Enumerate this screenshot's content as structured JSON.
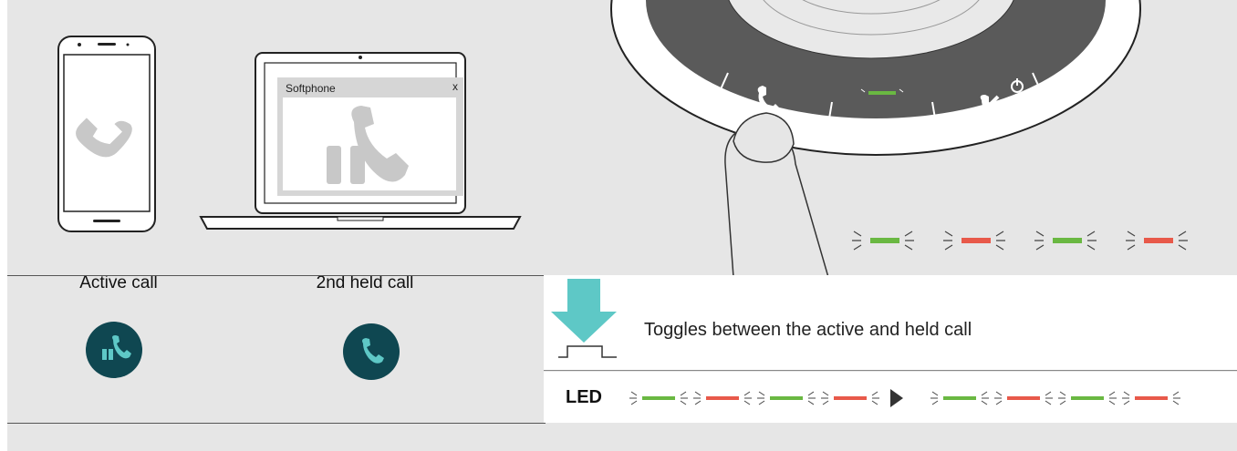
{
  "captions": {
    "active_call": "Active call",
    "held_call": "2nd held call"
  },
  "laptop": {
    "window_title": "Softphone",
    "close_label": "x"
  },
  "instruction": {
    "text": "Toggles between the active and held call"
  },
  "led": {
    "label": "LED",
    "sequence_before": [
      "green",
      "red",
      "green",
      "red"
    ],
    "sequence_after": [
      "green",
      "red",
      "green",
      "red"
    ],
    "top_sequence": [
      "green",
      "red",
      "green",
      "red"
    ]
  },
  "colors": {
    "led_green": "#6ab842",
    "led_red": "#e8594a",
    "teal_accent": "#5ec8c6",
    "button_dark": "#0f4751",
    "speaker_gray": "#5a5a5a",
    "phone_gray": "#c8c8c8"
  },
  "icons": [
    "phone-handset-icon",
    "hold-icon",
    "hangup-icon",
    "power-icon",
    "more-dots-icon",
    "press-arrow-icon"
  ]
}
